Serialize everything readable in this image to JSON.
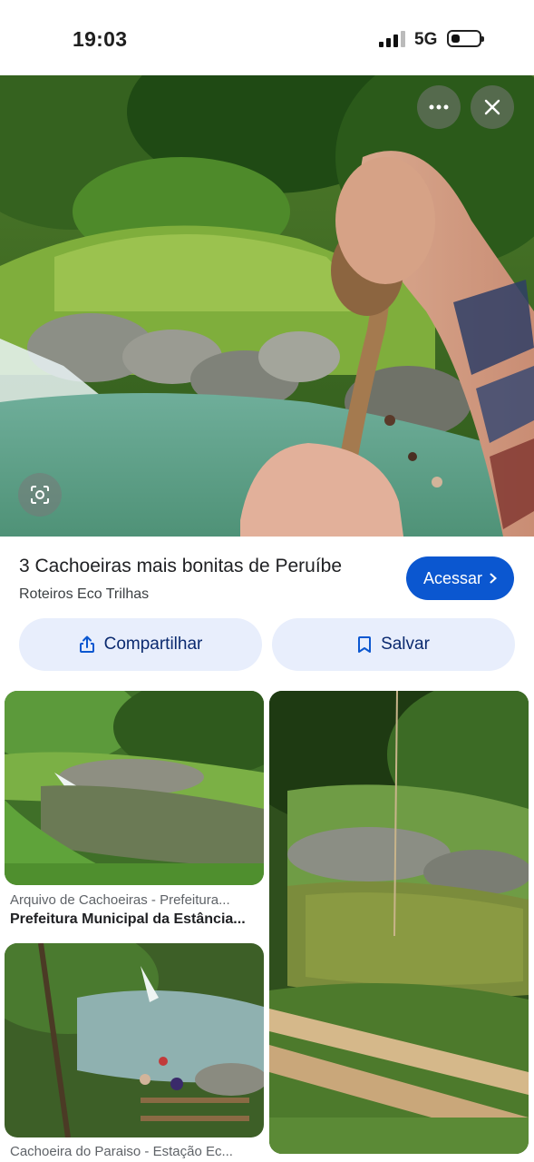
{
  "status_bar": {
    "time": "19:03",
    "network": "5G",
    "signal_icon": "cellular-signal-icon",
    "battery_icon": "battery-low-icon"
  },
  "hero": {
    "image_description_icon": "waterfall-rope-photo",
    "more_icon": "more-horizontal-icon",
    "close_icon": "close-icon",
    "lens_icon": "lens-search-icon"
  },
  "result": {
    "title": "3 Cachoeiras mais bonitas de Peruíbe",
    "source": "Roteiros Eco Trilhas",
    "visit_label": "Acessar",
    "visit_color": "#0b57d0"
  },
  "actions": {
    "share_label": "Compartilhar",
    "save_label": "Salvar"
  },
  "grid": {
    "items": [
      {
        "source": "Arquivo de Cachoeiras - Prefeitura...",
        "title": "Prefeitura Municipal da Estância..."
      },
      {
        "source": "Cachoeira do Paraiso - Estação Ec...",
        "title": ""
      }
    ]
  }
}
